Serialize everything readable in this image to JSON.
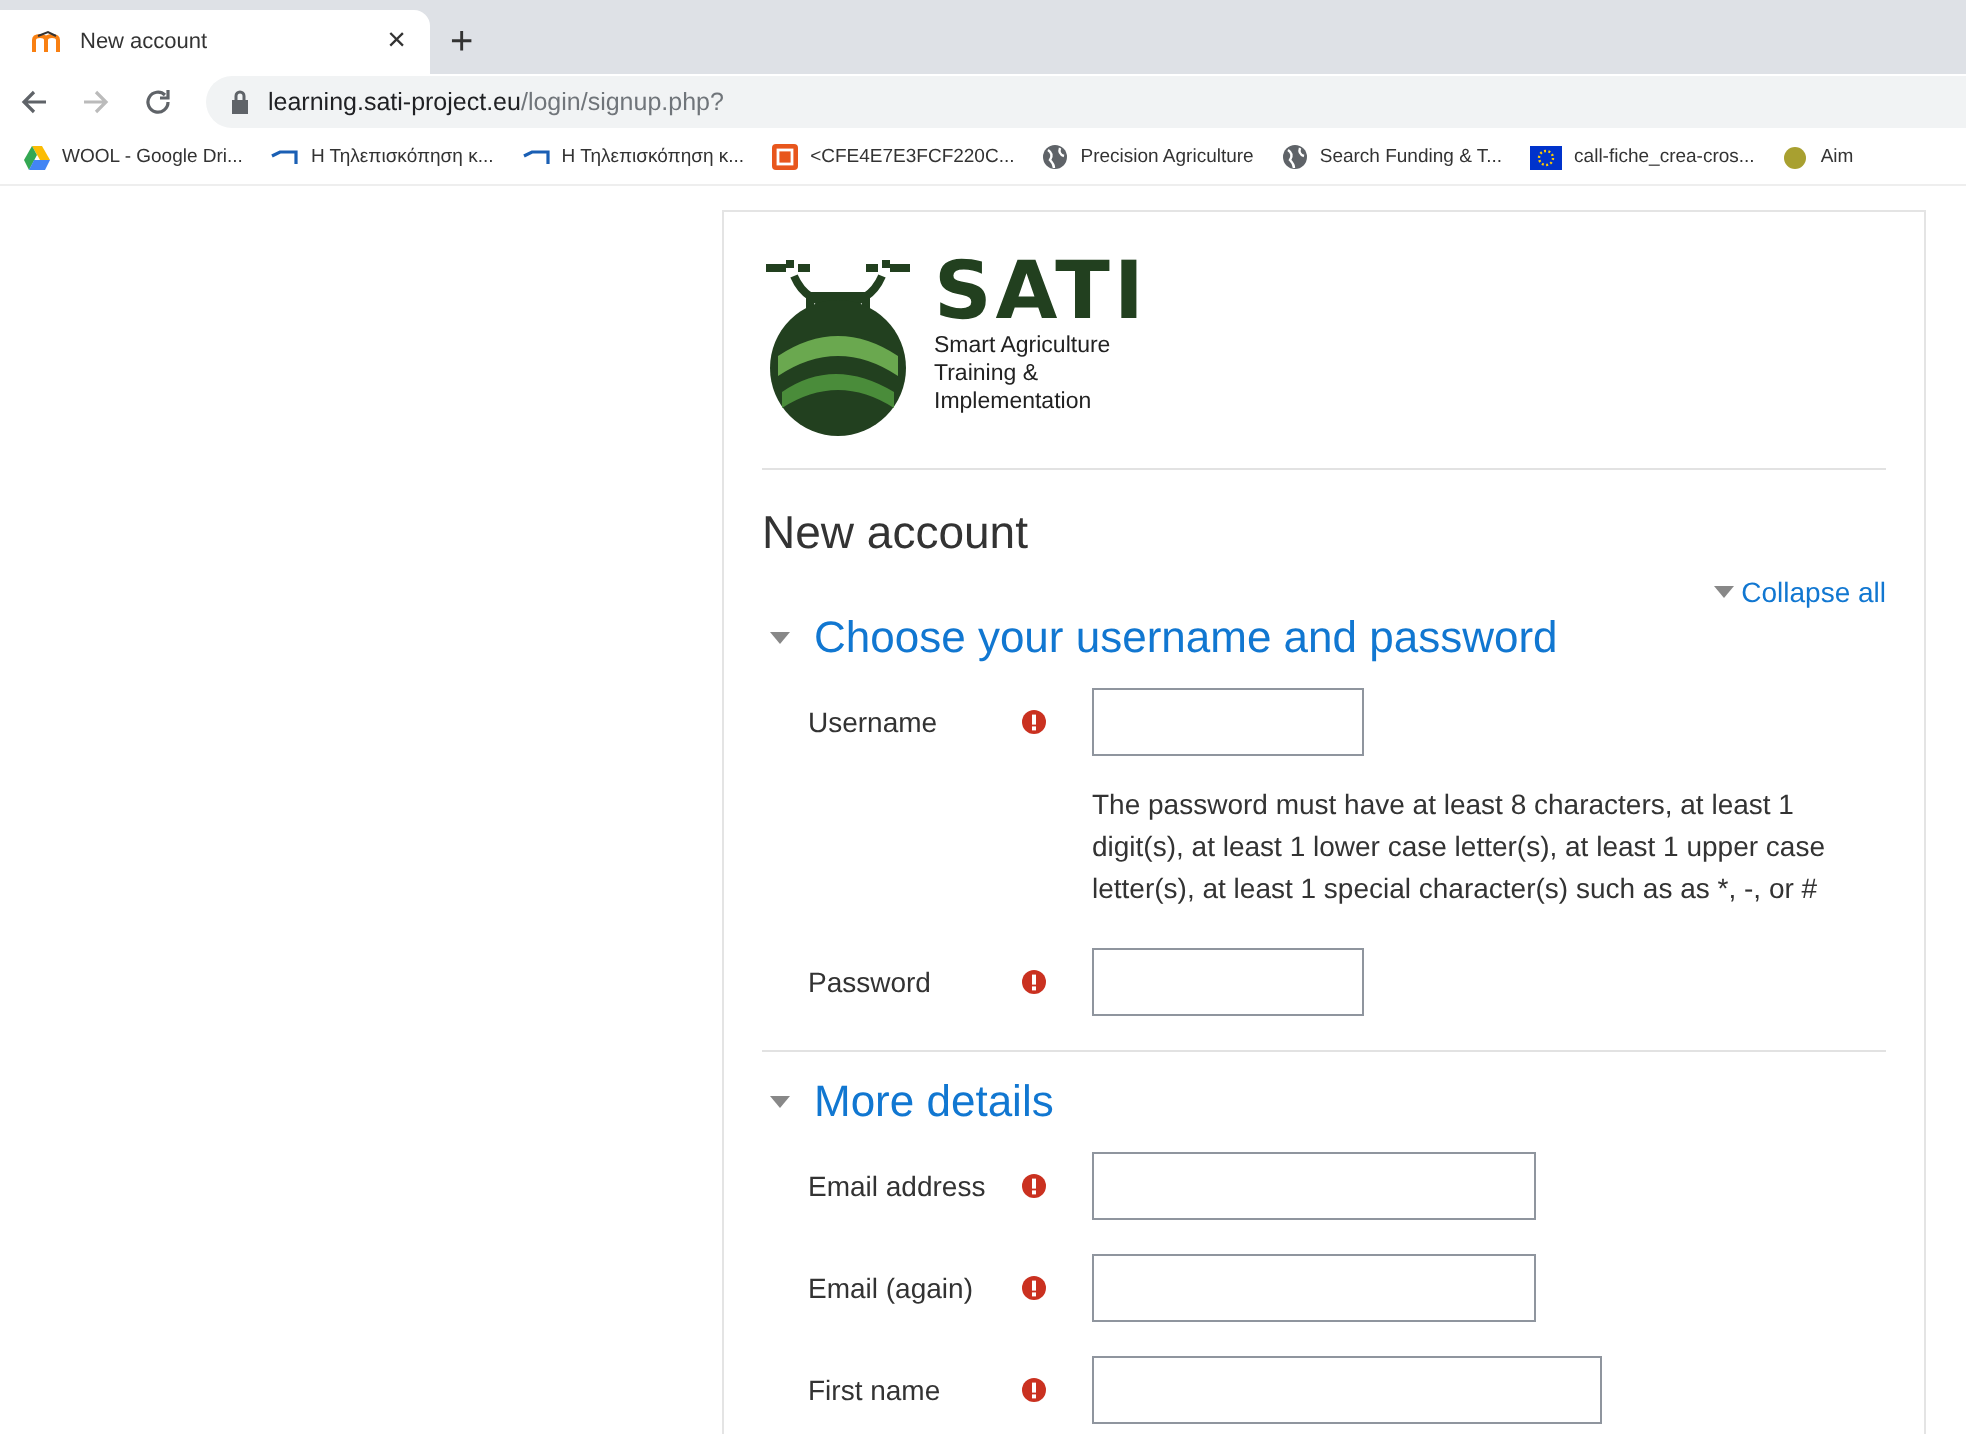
{
  "browser": {
    "tab": {
      "title": "New account",
      "close": "×"
    },
    "new_tab": "+",
    "url": {
      "host": "learning.sati-project.eu",
      "path": "/login/signup.php?"
    },
    "bookmarks": [
      {
        "kind": "drive",
        "label": "WOOL - Google Dri..."
      },
      {
        "kind": "bracket",
        "label": "Η Τηλεπισκόπηση κ..."
      },
      {
        "kind": "bracket",
        "label": "Η Τηλεπισκόπηση κ..."
      },
      {
        "kind": "orange",
        "label": "<CFE4E7E3FCF220C..."
      },
      {
        "kind": "globe",
        "label": "Precision Agriculture"
      },
      {
        "kind": "globe",
        "label": "Search Funding & T..."
      },
      {
        "kind": "eu",
        "label": "call-fiche_crea-cros..."
      },
      {
        "kind": "badge",
        "label": "Aim"
      }
    ]
  },
  "logo": {
    "title": "SATI",
    "subtitle": [
      "Smart Agriculture",
      "Training &",
      "Implementation"
    ]
  },
  "heading": "New account",
  "collapse_all": "Collapse all",
  "sections": [
    {
      "title": "Choose your username and password",
      "expanded": true,
      "fields": [
        {
          "kind": "input",
          "label": "Username",
          "required": true
        },
        {
          "kind": "note",
          "text": "The password must have at least 8 characters, at least 1 digit(s), at least 1 lower case letter(s), at least 1 upper case letter(s), at least 1 special character(s) such as as *, -, or #"
        },
        {
          "kind": "input",
          "label": "Password",
          "required": true
        }
      ]
    },
    {
      "title": "More details",
      "expanded": true,
      "fields": [
        {
          "kind": "input",
          "label": "Email address",
          "required": true
        },
        {
          "kind": "input",
          "label": "Email (again)",
          "required": true
        },
        {
          "kind": "input",
          "label": "First name",
          "required": true
        }
      ]
    }
  ]
}
